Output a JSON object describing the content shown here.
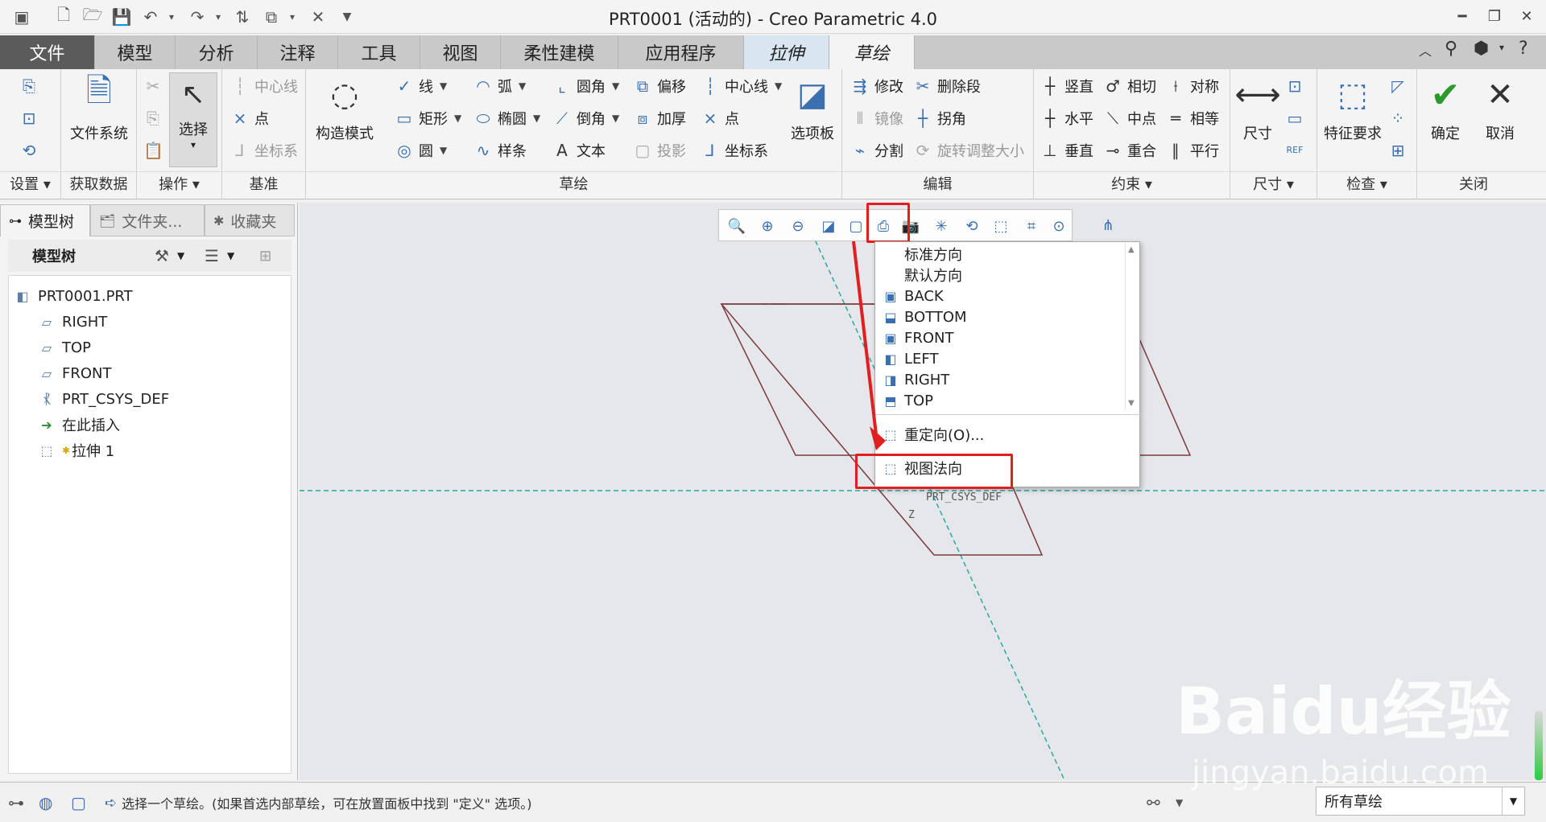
{
  "window": {
    "title": "PRT0001 (活动的) - Creo Parametric 4.0"
  },
  "tabs": [
    {
      "label": "文件",
      "kind": "file"
    },
    {
      "label": "模型"
    },
    {
      "label": "分析"
    },
    {
      "label": "注释"
    },
    {
      "label": "工具"
    },
    {
      "label": "视图"
    },
    {
      "label": "柔性建模"
    },
    {
      "label": "应用程序"
    },
    {
      "label": "拉伸",
      "kind": "ctx"
    },
    {
      "label": "草绘",
      "kind": "active"
    }
  ],
  "ribbon": {
    "groups": {
      "settings": "设置",
      "get_data": "获取数据",
      "operations": "操作",
      "datum": "基准",
      "sketch": "草绘",
      "edit": "编辑",
      "constrain": "约束",
      "dimension": "尺寸",
      "inspect": "检查",
      "close": "关闭"
    },
    "file_system": "文件系统",
    "select": "选择",
    "datum_items": [
      "中心线",
      "点",
      "坐标系"
    ],
    "construction_mode": "构造模式",
    "sketch_col1": [
      "线",
      "矩形",
      "圆"
    ],
    "sketch_col2": [
      "弧",
      "椭圆",
      "样条"
    ],
    "sketch_col3": [
      "圆角",
      "倒角",
      "文本"
    ],
    "sketch_col4": [
      "偏移",
      "加厚",
      "投影"
    ],
    "sketch_col5": [
      "中心线",
      "点",
      "坐标系"
    ],
    "palette": "选项板",
    "edit_col1": [
      "修改",
      "镜像",
      "分割"
    ],
    "edit_col2": [
      "删除段",
      "拐角",
      "旋转调整大小"
    ],
    "constrain_col1": [
      "竖直",
      "水平",
      "垂直"
    ],
    "constrain_col2": [
      "相切",
      "中点",
      "重合"
    ],
    "constrain_col3": [
      "对称",
      "相等",
      "平行"
    ],
    "dimension_btn": "尺寸",
    "feature_req": "特征要求",
    "ok": "确定",
    "cancel": "取消"
  },
  "left_panel": {
    "tabs": [
      "模型树",
      "文件夹...",
      "收藏夹"
    ],
    "header": "模型树",
    "nodes": [
      "PRT0001.PRT",
      "RIGHT",
      "TOP",
      "FRONT",
      "PRT_CSYS_DEF",
      "在此插入",
      "拉伸 1"
    ]
  },
  "view_menu": {
    "items": [
      "标准方向",
      "默认方向",
      "BACK",
      "BOTTOM",
      "FRONT",
      "LEFT",
      "RIGHT",
      "TOP"
    ],
    "reorient": "重定向(O)...",
    "view_normal": "视图法向"
  },
  "canvas": {
    "csys_label": "PRT_CSYS_DEF",
    "z_label": "Z"
  },
  "status": {
    "message": "选择一个草绘。(如果首选内部草绘，可在放置面板中找到 \"定义\" 选项。)",
    "filter": "所有草绘"
  },
  "watermark": {
    "brand": "Bai",
    "brand2": "du经验",
    "url": "jingyan.baidu.com"
  },
  "colors": {
    "accent": "#3a6fb0",
    "highlight": "#e02020",
    "file_tab": "#5b5b5b",
    "sketch_line": "#7a3a40",
    "datum_line": "#2aa8a8"
  }
}
